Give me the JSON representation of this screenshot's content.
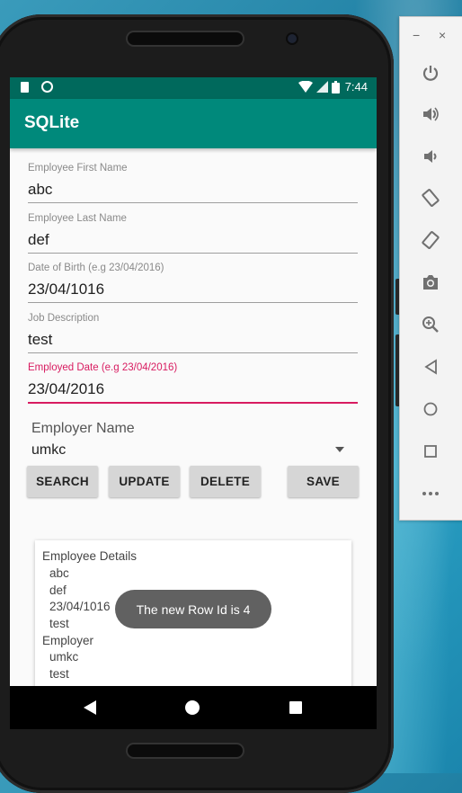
{
  "status_bar": {
    "time": "7:44"
  },
  "app": {
    "title": "SQLite"
  },
  "form": {
    "first_name_label": "Employee First Name",
    "first_name_value": "abc",
    "last_name_label": "Employee Last Name",
    "last_name_value": "def",
    "dob_label": "Date of Birth (e.g 23/04/2016)",
    "dob_value": "23/04/1016",
    "job_label": "Job Description",
    "job_value": "test",
    "employed_label": "Employed Date (e.g 23/04/2016)",
    "employed_value": "23/04/2016",
    "employer_label": "Employer Name",
    "employer_value": "umkc"
  },
  "buttons": {
    "search": "SEARCH",
    "update": "UPDATE",
    "delete": "DELETE",
    "save": "SAVE"
  },
  "details": {
    "lines": [
      "Employee Details",
      "abc",
      "def",
      "23/04/1016",
      "test",
      "Employer",
      "umkc",
      "test"
    ]
  },
  "toast": {
    "message": "The new Row Id is 4"
  },
  "toolbar": {
    "minimize": "−",
    "close": "×",
    "icons": [
      "power-icon",
      "volume-up-icon",
      "volume-down-icon",
      "rotate-left-icon",
      "rotate-right-icon",
      "camera-icon",
      "zoom-icon",
      "back-icon",
      "home-icon",
      "overview-icon",
      "more-icon"
    ]
  },
  "colors": {
    "primary": "#00897b",
    "primary_dark": "#00695c",
    "accent": "#d81b60"
  }
}
